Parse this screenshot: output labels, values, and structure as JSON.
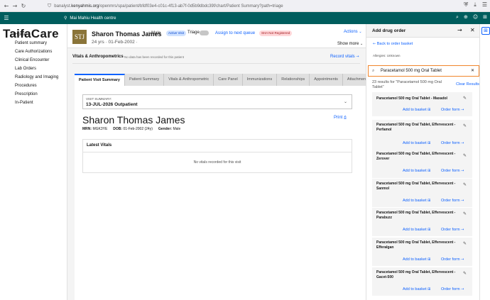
{
  "browser": {
    "back": "←",
    "forward": "→",
    "reload": "↻",
    "url_prefix": "banalyst.",
    "url_host": "kenyahmis.org",
    "url_path": "/openmrs/spa/patient/bfdf03e4-c01c-4f13-ab7f-0d5b9dbdc39f/chart/Patient Summary?path=triage"
  },
  "header": {
    "location": "Mai Mahiu Health centre"
  },
  "logo": "TaifaCare",
  "sidebar": {
    "items": [
      {
        "label": "Home"
      },
      {
        "label": "Patient summary"
      },
      {
        "label": "Care Authorizations"
      },
      {
        "label": "Clinical Encounter"
      },
      {
        "label": "Lab Orders"
      },
      {
        "label": "Radiology and Imaging"
      },
      {
        "label": "Procedures"
      },
      {
        "label": "Prescription"
      },
      {
        "label": "In-Patient"
      }
    ]
  },
  "banner": {
    "avatar_initials": "STJ",
    "name": "Sharon Thomas James",
    "gender": "♂ Male",
    "status_tag": "Active Visit",
    "triage_label": "Triage",
    "assign_link": "Assign to next queue",
    "sha_tag": "SHA  Not Registered",
    "actions": "Actions",
    "meta": "24 yrs  ·  01-Feb-2002  ·",
    "show_more": "Show more"
  },
  "vitals": {
    "title": "Vitals & Anthropometrics",
    "note": "No data has been recorded for this patient",
    "record_link": "Record vitals"
  },
  "tabs": [
    {
      "label": "Patient Visit Summary",
      "active": true
    },
    {
      "label": "Patient Summary"
    },
    {
      "label": "Vitals & Anthropometric"
    },
    {
      "label": "Care Panel"
    },
    {
      "label": "Immunizations"
    },
    {
      "label": "Relationships"
    },
    {
      "label": "Appointments"
    },
    {
      "label": "Attachments"
    }
  ],
  "visit": {
    "label": "VISIT SUMMARY:",
    "date": "13-JUL-2026 Outpatient",
    "patient_name": "Sharon Thomas James",
    "print": "Print",
    "mrn_label": "MRN:",
    "mrn": "MGK3YE",
    "dob_label": "DOB:",
    "dob": "01-Feb-2002 (24y)",
    "gender_label": "Gender:",
    "gender": "Male",
    "latest_vitals_title": "Latest Vitals",
    "no_vitals": "No vitals recorded for this visit"
  },
  "drug_panel": {
    "title": "Add drug order",
    "back_link": "Back to order basket",
    "allergies": "Allergies: Unknown",
    "search_value": "Paracetamol 500 mg Oral Tablet",
    "results_text": "23 results for \"Paracetamol 500 mg Oral Tablet\"",
    "clear_results": "Clear Results",
    "add_label": "Add to basket",
    "order_label": "Order form",
    "drugs": [
      {
        "name": "Paracetamol 500 mg Oral Tablet - Maxadol"
      },
      {
        "name": "Paracetamol 500 mg Oral Tablet, Effervescent - Perfamol"
      },
      {
        "name": "Paracetamol 500 mg Oral Tablet, Effervescent - Zerover"
      },
      {
        "name": "Paracetamol 500 mg Oral Tablet, Effervescent - Sanmol"
      },
      {
        "name": "Paracetamol 500 mg Oral Tablet, Effervescent - Parabuzz"
      },
      {
        "name": "Paracetamol 500 mg Oral Tablet, Effervescent - Efferalgan"
      },
      {
        "name": "Paracetamol 500 mg Oral Tablet, Effervescent - Gacet-500"
      }
    ]
  },
  "colors": {
    "header": "#005d5d",
    "link": "#0f62fe",
    "search_border": "#f1852b"
  }
}
